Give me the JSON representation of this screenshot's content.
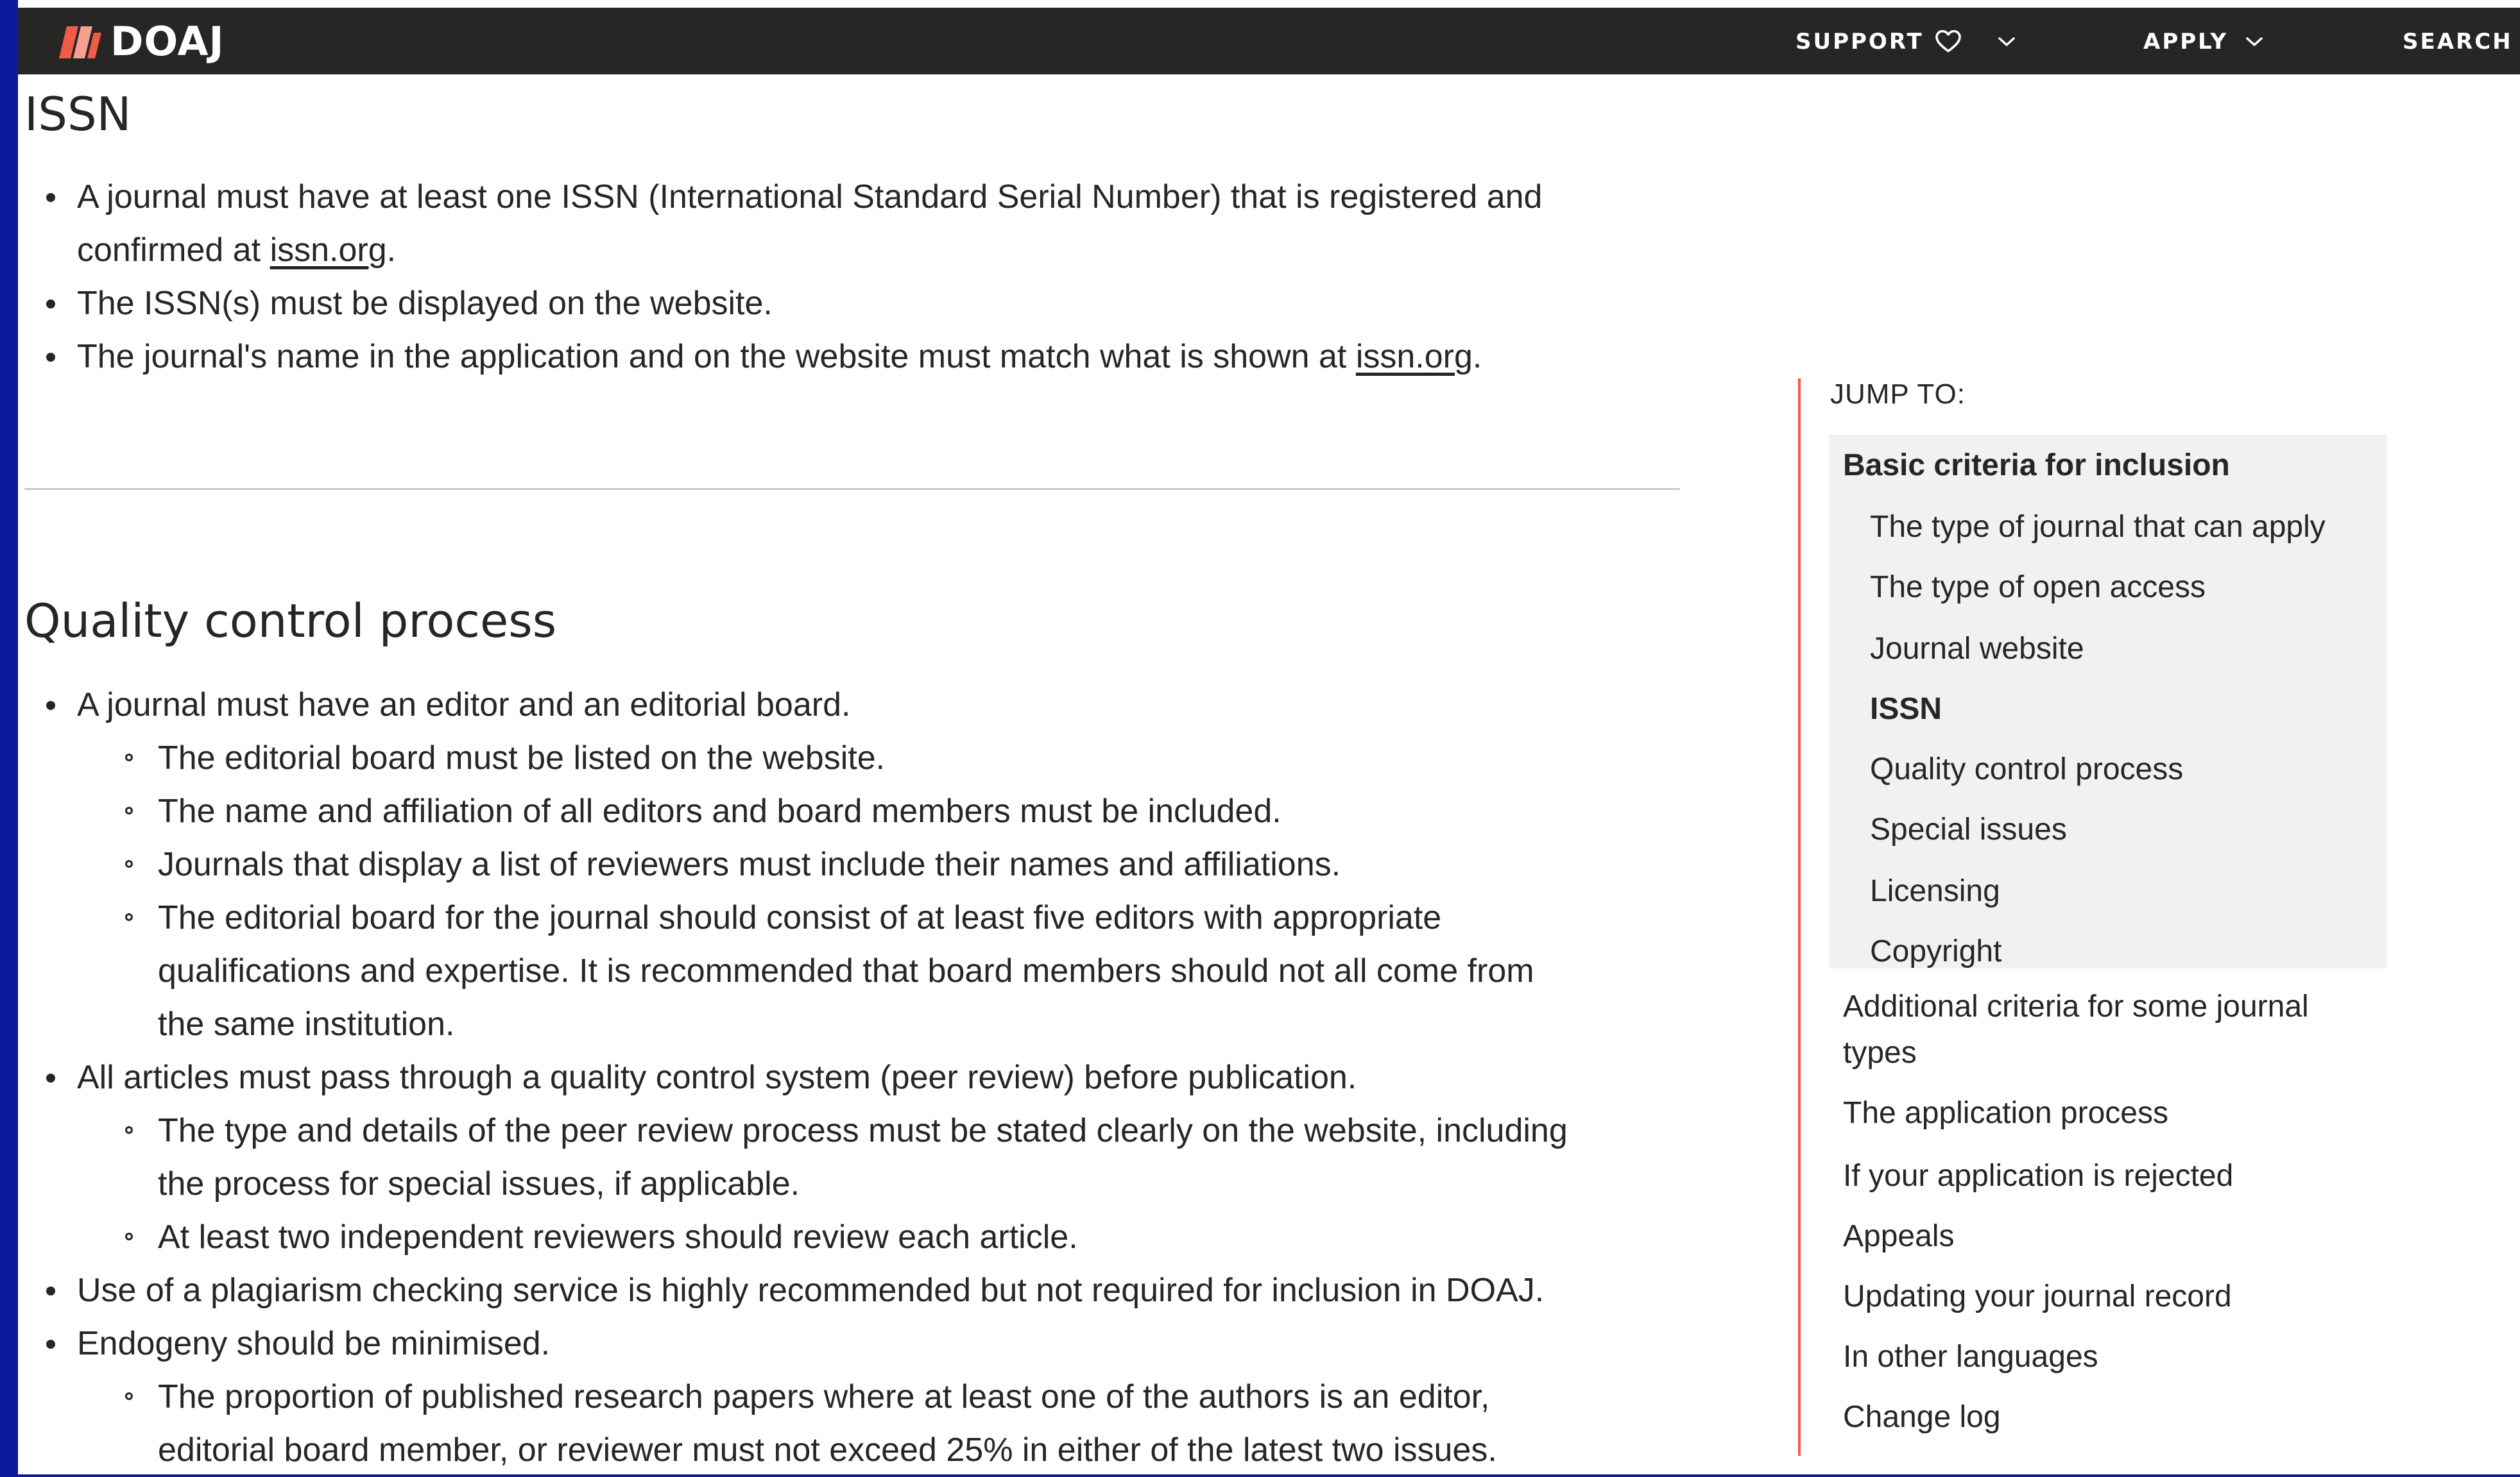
{
  "nav": {
    "logo_text": "DOAJ",
    "items": [
      {
        "label": "SUPPORT"
      },
      {
        "label": "APPLY"
      },
      {
        "label": "SEARCH"
      }
    ]
  },
  "colors": {
    "nav_bg": "#282624",
    "accent": "#f25a4a",
    "outer_bg": "#0a1a9c",
    "toc_bg": "#f2f1ef"
  },
  "issn": {
    "heading": "ISSN",
    "b1_text": "A journal must have at least one ISSN (International Standard Serial Number) that is registered and",
    "b1_cont": "confirmed at ",
    "b1_link": "issn.org",
    "b1_end": ".",
    "b2": "The ISSN(s) must be displayed on the website.",
    "b3_text": "The journal's name in the application and on the website must match what is shown at ",
    "b3_link": "issn.org",
    "b3_end": "."
  },
  "quality": {
    "heading": "Quality control process",
    "lines": [
      {
        "level": 1,
        "text": "A journal must have an editor and an editorial board."
      },
      {
        "level": 2,
        "text": "The editorial board must be listed on the website."
      },
      {
        "level": 2,
        "text": "The name and affiliation of all editors and board members must be included."
      },
      {
        "level": 2,
        "text": "Journals that display a list of reviewers must include their names and affiliations."
      },
      {
        "level": 2,
        "text": "The editorial board for the journal should consist of at least five editors with appropriate"
      },
      {
        "level": 0,
        "text": "qualifications and expertise. It is recommended that board members should not all come from"
      },
      {
        "level": 0,
        "text": "the same institution."
      },
      {
        "level": 1,
        "text": "All articles must pass through a quality control system (peer review) before publication."
      },
      {
        "level": 2,
        "text": "The type and details of the peer review process must be stated clearly on the website, including"
      },
      {
        "level": 0,
        "text": "the process for special issues, if applicable."
      },
      {
        "level": 2,
        "text": "At least two independent reviewers should review each article."
      },
      {
        "level": 1,
        "text": "Use of a plagiarism checking service is highly recommended but not required for inclusion in DOAJ."
      },
      {
        "level": 1,
        "text": "Endogeny should be minimised."
      },
      {
        "level": 2,
        "text": "The proportion of published research papers where at least one of the authors is an editor,"
      },
      {
        "level": 0,
        "text": "editorial board member, or reviewer must not exceed 25% in either of the latest two issues."
      }
    ]
  },
  "toc": {
    "label": "JUMP TO:",
    "group_title": "Basic criteria for inclusion",
    "group_items": [
      {
        "text": "The type of journal that can apply",
        "active": false
      },
      {
        "text": "The type of open access",
        "active": false
      },
      {
        "text": "Journal website",
        "active": false
      },
      {
        "text": "ISSN",
        "active": true
      },
      {
        "text": "Quality control process",
        "active": false
      },
      {
        "text": "Special issues",
        "active": false
      },
      {
        "text": "Licensing",
        "active": false
      },
      {
        "text": "Copyright",
        "active": false
      }
    ],
    "additional_line1": "Additional criteria for some journal",
    "additional_line2": "types",
    "items": [
      "The application process",
      "If your application is rejected",
      "Appeals",
      "Updating your journal record",
      "In other languages",
      "Change log"
    ]
  }
}
